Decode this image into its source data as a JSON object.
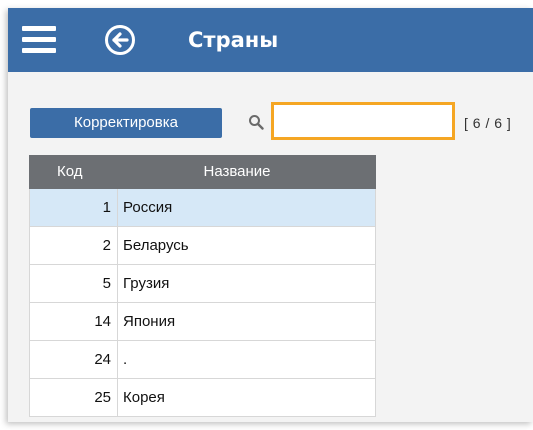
{
  "header": {
    "title": "Страны",
    "menu_icon": "hamburger-menu-icon",
    "back_icon": "back-arrow-circle-icon",
    "background": "#3b6da7"
  },
  "toolbar": {
    "edit_label": "Корректировка",
    "search_icon": "magnifier-icon",
    "search_value": "",
    "search_placeholder": "",
    "counter": "[ 6 / 6 ]",
    "focus_color": "#f5a623"
  },
  "table": {
    "columns": [
      "Код",
      "Название"
    ],
    "rows": [
      {
        "code": "1",
        "name": "Россия",
        "selected": true
      },
      {
        "code": "2",
        "name": "Беларусь",
        "selected": false
      },
      {
        "code": "5",
        "name": "Грузия",
        "selected": false
      },
      {
        "code": "14",
        "name": "Япония",
        "selected": false
      },
      {
        "code": "24",
        "name": ".",
        "selected": false
      },
      {
        "code": "25",
        "name": "Корея",
        "selected": false
      }
    ],
    "selected_color": "#d6e8f7",
    "header_color": "#6c6f73"
  }
}
